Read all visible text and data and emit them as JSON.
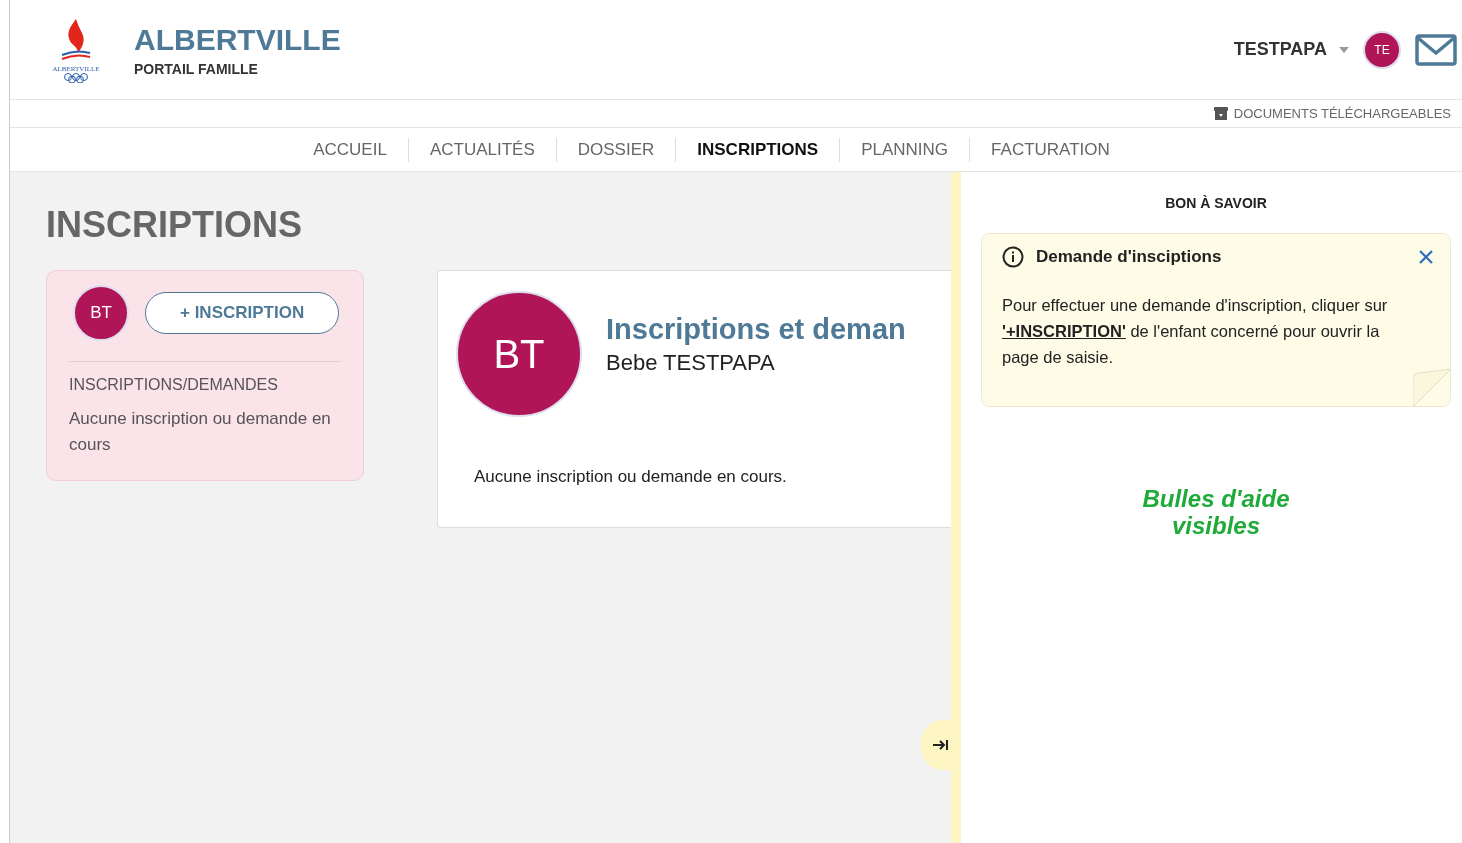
{
  "header": {
    "logo_caption": "ALBERTVILLE",
    "title": "ALBERTVILLE",
    "subtitle": "PORTAIL FAMILLE",
    "user": {
      "name": "TESTPAPA",
      "initials": "TE"
    }
  },
  "documents_link": "DOCUMENTS TÉLÉCHARGEABLES",
  "nav": [
    {
      "label": "ACCUEIL",
      "selected": false
    },
    {
      "label": "ACTUALITÉS",
      "selected": false
    },
    {
      "label": "DOSSIER",
      "selected": false
    },
    {
      "label": "INSCRIPTIONS",
      "selected": true
    },
    {
      "label": "PLANNING",
      "selected": false
    },
    {
      "label": "FACTURATION",
      "selected": false
    }
  ],
  "page_title": "INSCRIPTIONS",
  "child_card": {
    "initials": "BT",
    "button": "+ INSCRIPTION",
    "section": "INSCRIPTIONS/DEMANDES",
    "status": "Aucune inscription ou demande en cours"
  },
  "detail": {
    "initials": "BT",
    "title": "Inscriptions et deman",
    "name": "Bebe TESTPAPA",
    "message": "Aucune inscription ou demande en cours."
  },
  "help_panel": {
    "heading": "BON À SAVOIR",
    "tip": {
      "title": "Demande d'insciptions",
      "text": "Pour effectuer une demande d'inscription, cliquer sur **'+INSCRIPTION'** de l'enfant concerné pour ouvrir la page de saisie."
    },
    "status": "Bulles d'aide visibles"
  }
}
